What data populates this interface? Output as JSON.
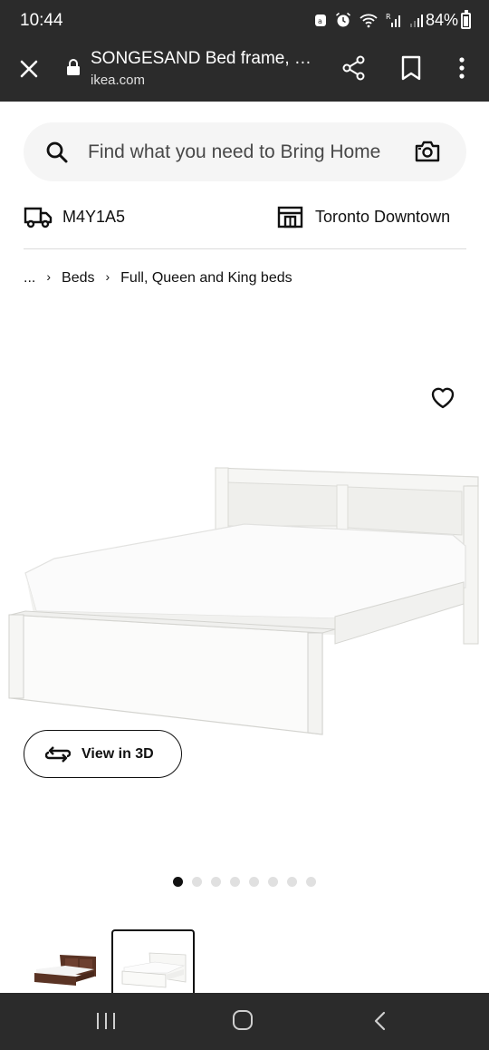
{
  "status_bar": {
    "time": "10:44",
    "battery": "84%"
  },
  "browser": {
    "title": "SONGESAND Bed frame, …",
    "url": "ikea.com"
  },
  "search": {
    "placeholder": "Find what you need to Bring Home"
  },
  "location": {
    "postal_code": "M4Y1A5",
    "store": "Toronto Downtown"
  },
  "breadcrumb": {
    "ellipsis": "...",
    "items": [
      "Beds",
      "Full, Queen and King beds"
    ]
  },
  "product": {
    "view_3d_label": "View in 3D",
    "carousel_total": 8,
    "carousel_active": 1
  },
  "colors": {
    "system_bar": "#2b2b2b",
    "search_bg": "#f5f5f5",
    "dot_active": "#111111",
    "dot_inactive": "#e0e0e0"
  }
}
